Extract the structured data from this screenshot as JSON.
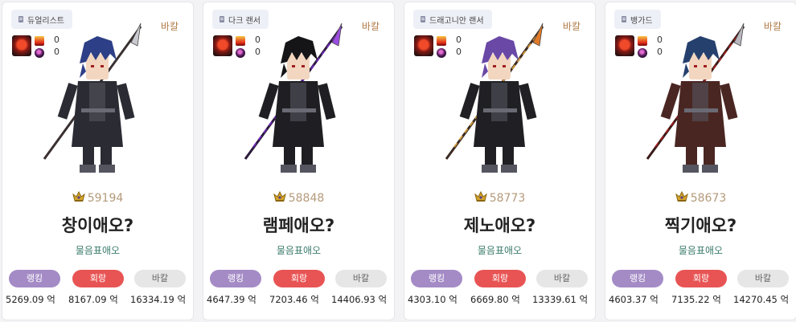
{
  "cards": [
    {
      "job": "듀얼리스트",
      "server": "바칼",
      "stat_top": "0",
      "stat_bottom": "0",
      "score": "59194",
      "name": "창이애오?",
      "guild": "물음표애오",
      "tabs": [
        "랭킹",
        "회랑",
        "바칼"
      ],
      "values": [
        "5269.09 억",
        "8167.09 억",
        "16334.19 억"
      ],
      "hair_color": "#2d3f86",
      "outfit_color": "#2b2b33",
      "weapon": "spear"
    },
    {
      "job": "다크 랜서",
      "server": "바칼",
      "stat_top": "0",
      "stat_bottom": "0",
      "score": "58848",
      "name": "램페애오?",
      "guild": "물음표애오",
      "tabs": [
        "랭킹",
        "회랑",
        "바칼"
      ],
      "values": [
        "4647.39 억",
        "7203.46 억",
        "14406.93 억"
      ],
      "hair_color": "#151518",
      "outfit_color": "#1f1f23",
      "weapon": "violet-spear"
    },
    {
      "job": "드래고니안 랜서",
      "server": "바칼",
      "stat_top": "0",
      "stat_bottom": "0",
      "score": "58773",
      "name": "제노애오?",
      "guild": "물음표애오",
      "tabs": [
        "랭킹",
        "회랑",
        "바칼"
      ],
      "values": [
        "4303.10 억",
        "6669.80 억",
        "13339.61 억"
      ],
      "hair_color": "#6a48a6",
      "outfit_color": "#202024",
      "weapon": "fire-spear"
    },
    {
      "job": "뱅가드",
      "server": "바칼",
      "stat_top": "0",
      "stat_bottom": "0",
      "score": "58673",
      "name": "찍기애오?",
      "guild": "물음표애오",
      "tabs": [
        "랭킹",
        "회랑",
        "바칼"
      ],
      "values": [
        "4603.37 억",
        "7135.22 억",
        "14270.45 억"
      ],
      "hair_color": "#26406e",
      "outfit_color": "#4a2622",
      "weapon": "red-spear"
    }
  ],
  "colors": {
    "tab_ranking": "#a48bc6",
    "tab_corridor": "#e85454",
    "tab_bakal": "#e6e6e6",
    "server_text": "#b07a46",
    "guild_text": "#3a7b6b",
    "score_text": "#b49a7a"
  }
}
